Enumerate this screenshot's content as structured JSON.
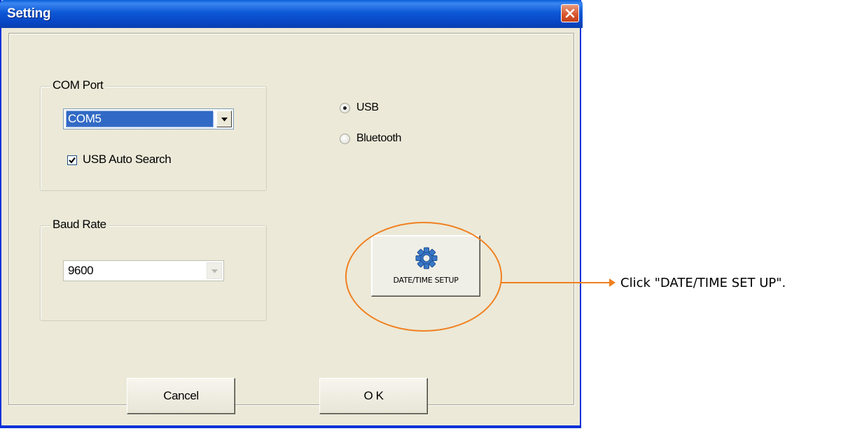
{
  "window": {
    "title": "Setting"
  },
  "com_port": {
    "group_label": "COM Port",
    "selected": "COM5",
    "usb_auto_search_label": "USB Auto Search",
    "usb_auto_search_checked": true
  },
  "connection": {
    "options": [
      "USB",
      "Bluetooth"
    ],
    "selected": "USB"
  },
  "baud_rate": {
    "group_label": "Baud Rate",
    "selected": "9600"
  },
  "buttons": {
    "datetime_setup": "DATE/TIME SETUP",
    "cancel": "Cancel",
    "ok": "O K"
  },
  "annotation": {
    "text": "Click \"DATE/TIME SET UP\".",
    "color": "#f08020"
  },
  "icons": [
    "close-icon",
    "dropdown-arrow-icon",
    "checkmark-icon",
    "gear-icon"
  ]
}
